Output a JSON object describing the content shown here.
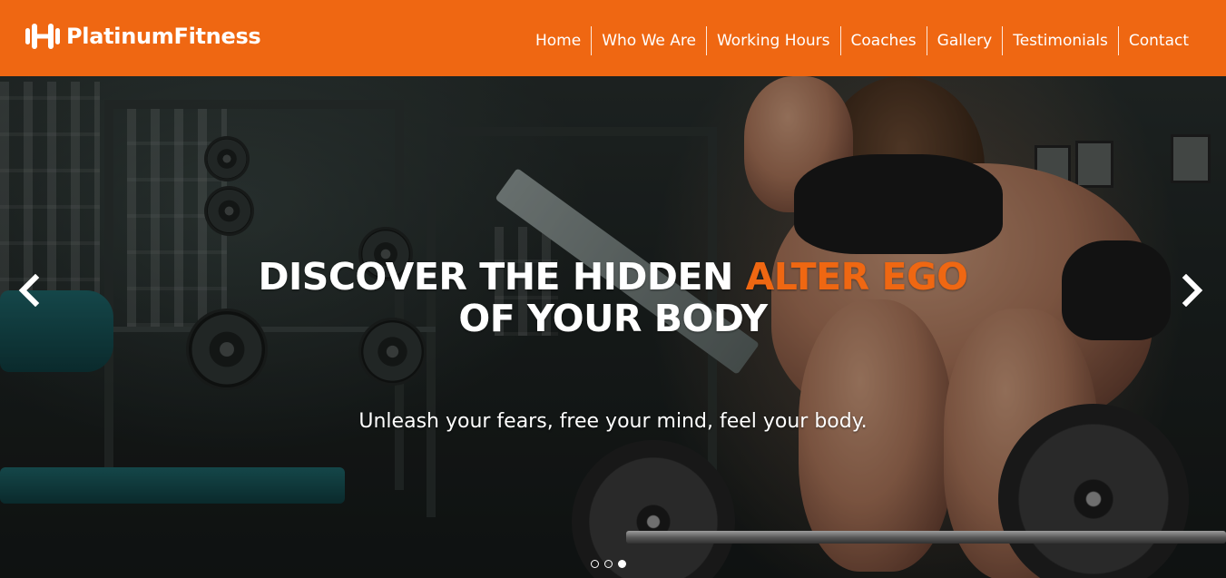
{
  "brand": {
    "name": "PlatinumFitness",
    "icon": "dumbbell-icon"
  },
  "nav": {
    "items": [
      {
        "label": "Home"
      },
      {
        "label": "Who We Are"
      },
      {
        "label": "Working Hours"
      },
      {
        "label": "Coaches"
      },
      {
        "label": "Gallery"
      },
      {
        "label": "Testimonials"
      },
      {
        "label": "Contact"
      }
    ]
  },
  "slide": {
    "headline_part1": "DISCOVER THE HIDDEN ",
    "headline_accent": "ALTER EGO",
    "headline_line2": "OF YOUR BODY",
    "subheadline": "Unleash your fears, free your mind, feel your body.",
    "prev_icon": "chevron-left-icon",
    "next_icon": "chevron-right-icon",
    "slide_count": 3,
    "active_slide": 3
  },
  "colors": {
    "accent": "#ef6712",
    "text": "#ffffff"
  }
}
